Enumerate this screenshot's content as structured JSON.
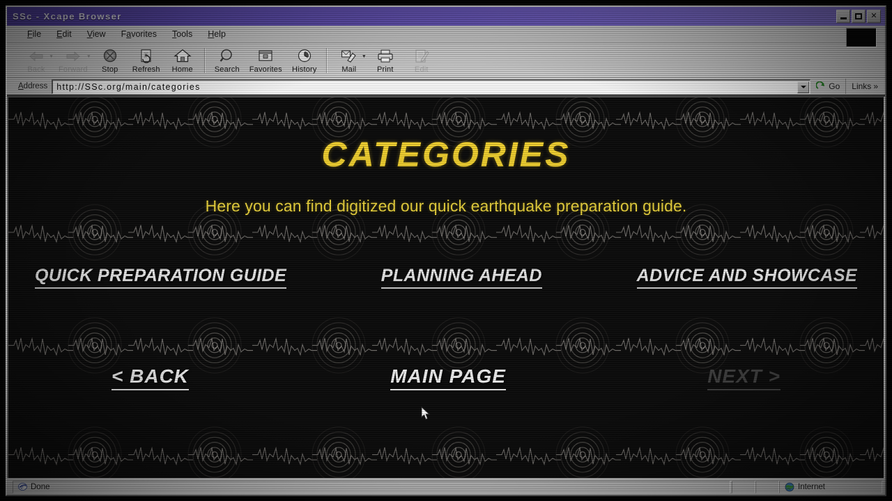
{
  "window": {
    "title": "SSc - Xcape Browser",
    "controls": [
      {
        "name": "minimize",
        "label": "_"
      },
      {
        "name": "maximize",
        "label": "□"
      },
      {
        "name": "close",
        "label": "✕"
      }
    ]
  },
  "menu": {
    "items": [
      {
        "label": "File",
        "accel": "F"
      },
      {
        "label": "Edit",
        "accel": "E"
      },
      {
        "label": "View",
        "accel": "V"
      },
      {
        "label": "Favorites",
        "accel": "a"
      },
      {
        "label": "Tools",
        "accel": "T"
      },
      {
        "label": "Help",
        "accel": "H"
      }
    ]
  },
  "toolbar": {
    "buttons": [
      {
        "label": "Back",
        "icon": "back-arrow-icon",
        "disabled": true,
        "has_menu": true
      },
      {
        "label": "Forward",
        "icon": "forward-arrow-icon",
        "disabled": true,
        "has_menu": true
      },
      {
        "label": "Stop",
        "icon": "stop-icon",
        "disabled": false,
        "has_menu": false
      },
      {
        "label": "Refresh",
        "icon": "refresh-icon",
        "disabled": false,
        "has_menu": false
      },
      {
        "label": "Home",
        "icon": "home-icon",
        "disabled": false,
        "has_menu": false
      },
      {
        "label": "Search",
        "icon": "search-icon",
        "disabled": false,
        "has_menu": false
      },
      {
        "label": "Favorites",
        "icon": "favorites-folder-icon",
        "disabled": false,
        "has_menu": false
      },
      {
        "label": "History",
        "icon": "history-clock-icon",
        "disabled": false,
        "has_menu": false
      },
      {
        "label": "Mail",
        "icon": "mail-icon",
        "disabled": false,
        "has_menu": true
      },
      {
        "label": "Print",
        "icon": "printer-icon",
        "disabled": false,
        "has_menu": false
      },
      {
        "label": "Edit",
        "icon": "edit-page-icon",
        "disabled": true,
        "has_menu": false
      }
    ]
  },
  "address": {
    "label": "Address",
    "url": "http://SSc.org/main/categories",
    "placeholder": "http://",
    "dropdown_icon": "chevron-down-icon",
    "go_label": "Go",
    "go_icon": "go-arrow-icon",
    "links_label": "Links",
    "links_chevron": "»"
  },
  "page": {
    "title": "CATEGORIES",
    "subtitle": "Here you can find digitized our quick earthquake preparation guide.",
    "category_links": [
      {
        "label": "QUICK PREPARATION GUIDE",
        "name": "quick-preparation-guide"
      },
      {
        "label": "PLANNING AHEAD",
        "name": "planning-ahead"
      },
      {
        "label": "ADVICE AND SHOWCASE",
        "name": "advice-and-showcase"
      }
    ],
    "nav_links": [
      {
        "label": "< BACK",
        "name": "back",
        "disabled": false
      },
      {
        "label": "MAIN PAGE",
        "name": "main-page",
        "disabled": false
      },
      {
        "label": "NEXT >",
        "name": "next",
        "disabled": true
      }
    ]
  },
  "status": {
    "text": "Done",
    "icon": "browser-e-icon",
    "zone_text": "Internet",
    "zone_icon": "globe-icon"
  },
  "colors": {
    "title_yellow": "#f0cf2e",
    "subtitle_yellow": "#e9d23b",
    "link_white": "#e6e6e6",
    "link_disabled": "#3e3e3e",
    "titlebar_purple": "#5d4bb5",
    "page_black": "#0a0a0a",
    "chrome_gray": "#c8c8c8"
  }
}
